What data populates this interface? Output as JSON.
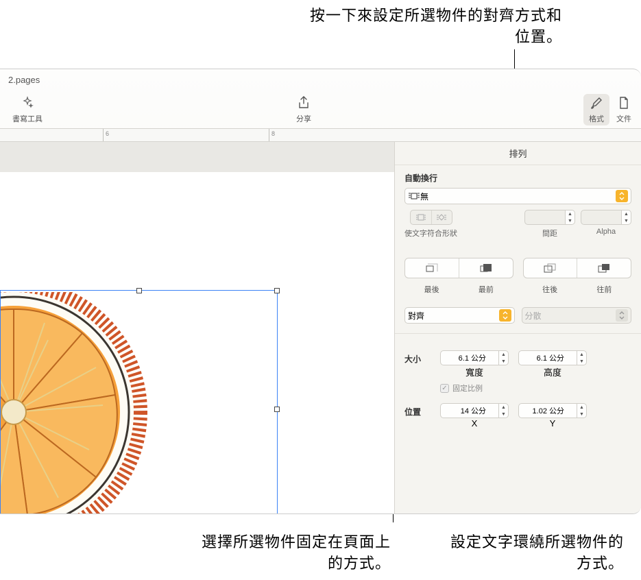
{
  "callouts": {
    "top": "按一下來設定所選物件的對齊方式和位置。",
    "bottom_left": "選擇所選物件固定在頁面上的方式。",
    "bottom_right": "設定文字環繞所選物件的方式。"
  },
  "window": {
    "title": "2.pages"
  },
  "toolbar": {
    "writing_tools": "書寫工具",
    "share": "分享",
    "format": "格式",
    "document": "文件"
  },
  "ruler": {
    "mark6": "6",
    "mark8": "8"
  },
  "inspector": {
    "tab": "排列",
    "wrap": {
      "label": "自動換行",
      "value": "無",
      "fit_shape": "使文字符合形狀",
      "spacing": "間距",
      "alpha": "Alpha"
    },
    "layers": {
      "back_most": "最後",
      "front_most": "最前",
      "backward": "往後",
      "forward": "往前"
    },
    "align": {
      "label": "對齊",
      "distribute": "分散"
    },
    "size": {
      "label": "大小",
      "width_val": "6.1 公分",
      "width_lab": "寬度",
      "height_val": "6.1 公分",
      "height_lab": "高度",
      "lock_ratio": "固定比例"
    },
    "position": {
      "label": "位置",
      "x_val": "14 公分",
      "x_lab": "X",
      "y_val": "1.02 公分",
      "y_lab": "Y"
    }
  }
}
